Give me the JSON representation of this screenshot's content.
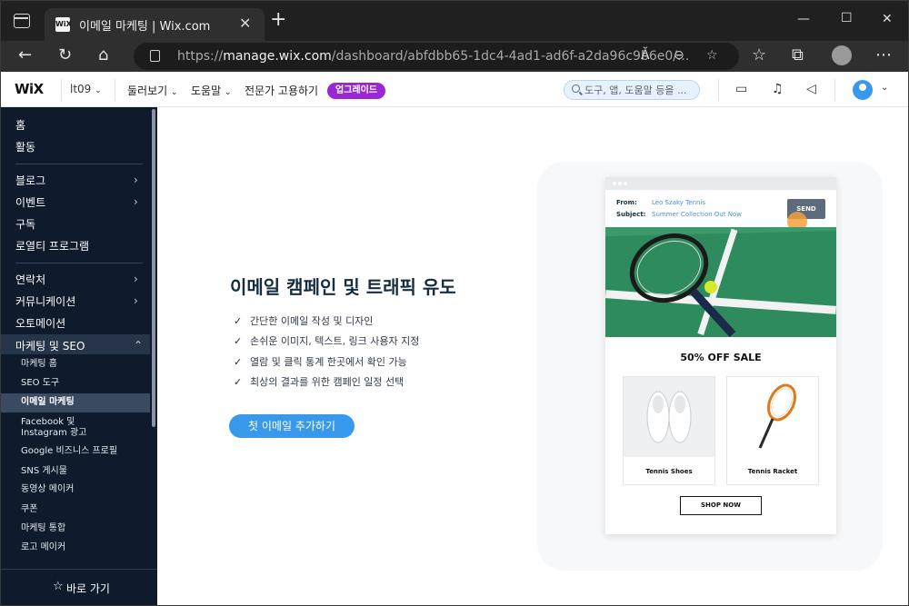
{
  "browser": {
    "tab_title": "이메일 마케팅 | Wix.com",
    "favicon_text": "WiX",
    "url_prefix": "https://",
    "url_host": "manage.wix.com",
    "url_path": "/dashboard/abfdbb65-1dc4-4ad1-ad6f-a2da96c9b6e0/...",
    "read_aloud_icon": "Ă"
  },
  "wix": {
    "logo": "WiX",
    "site_selector": "lt09",
    "nav": [
      "둘러보기",
      "도움말",
      "전문가 고용하기"
    ],
    "upgrade_label": "업그레이드",
    "search_placeholder": "도구, 앱, 도움말 등을 ..."
  },
  "sidebar": {
    "group1": [
      "홈",
      "활동"
    ],
    "group2": [
      "블로그",
      "이벤트",
      "구독",
      "로열티 프로그램"
    ],
    "group3": [
      "연락처",
      "커뮤니케이션",
      "오토메이션",
      "마케팅 및 SEO"
    ],
    "sub_items": [
      "마케팅 홈",
      "SEO 도구",
      "이메일 마케팅",
      "Facebook 및",
      "Instagram 광고",
      "Google 비즈니스 프로필",
      "SNS 게시물",
      "동영상 메이커",
      "쿠폰",
      "마케팅 통합",
      "로고 메이커"
    ],
    "quick_access": "바로 가기"
  },
  "main": {
    "headline": "이메일 캠페인 및 트래픽 유도",
    "features": [
      "간단한 이메일 작성 및 디자인",
      "손쉬운 이미지, 텍스트, 링크 사용자 지정",
      "열람 및 클릭 통계 한곳에서 확인 가능",
      "최상의 결과를 위한 캠페인 일정 선택"
    ],
    "cta_label": "첫 이메일 추가하기"
  },
  "email_mock": {
    "from_label": "From:",
    "from_value": "Leo Szaky Tennis",
    "subject_label": "Subject:",
    "subject_value": "Summer Collection Out Now",
    "send_label": "SEND",
    "sale_title": "50% OFF SALE",
    "products": [
      "Tennis Shoes",
      "Tennis Racket"
    ],
    "shop_label": "SHOP NOW"
  }
}
